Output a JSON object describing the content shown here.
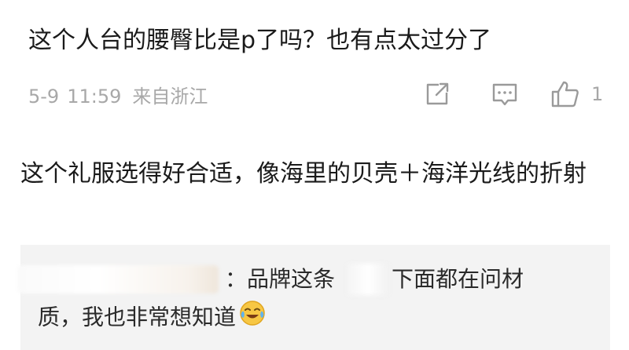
{
  "comment": {
    "text": "这个人台的腰臀比是p了吗？也有点太过分了",
    "date": "5-9",
    "time": "11:59",
    "location": "来自浙江",
    "like_count": "1",
    "icons": {
      "share": "share-icon",
      "reply": "comment-icon",
      "like": "thumbs-up-icon"
    }
  },
  "reply": {
    "text": "这个礼服选得好合适，像海里的贝壳＋海洋光线的折射"
  },
  "sub_reply": {
    "line1_part1": "：品牌这条",
    "line1_part2": "下面都在问材",
    "line2": "质，我也非常想知道",
    "emoji": "crying-laughing-emoji"
  }
}
